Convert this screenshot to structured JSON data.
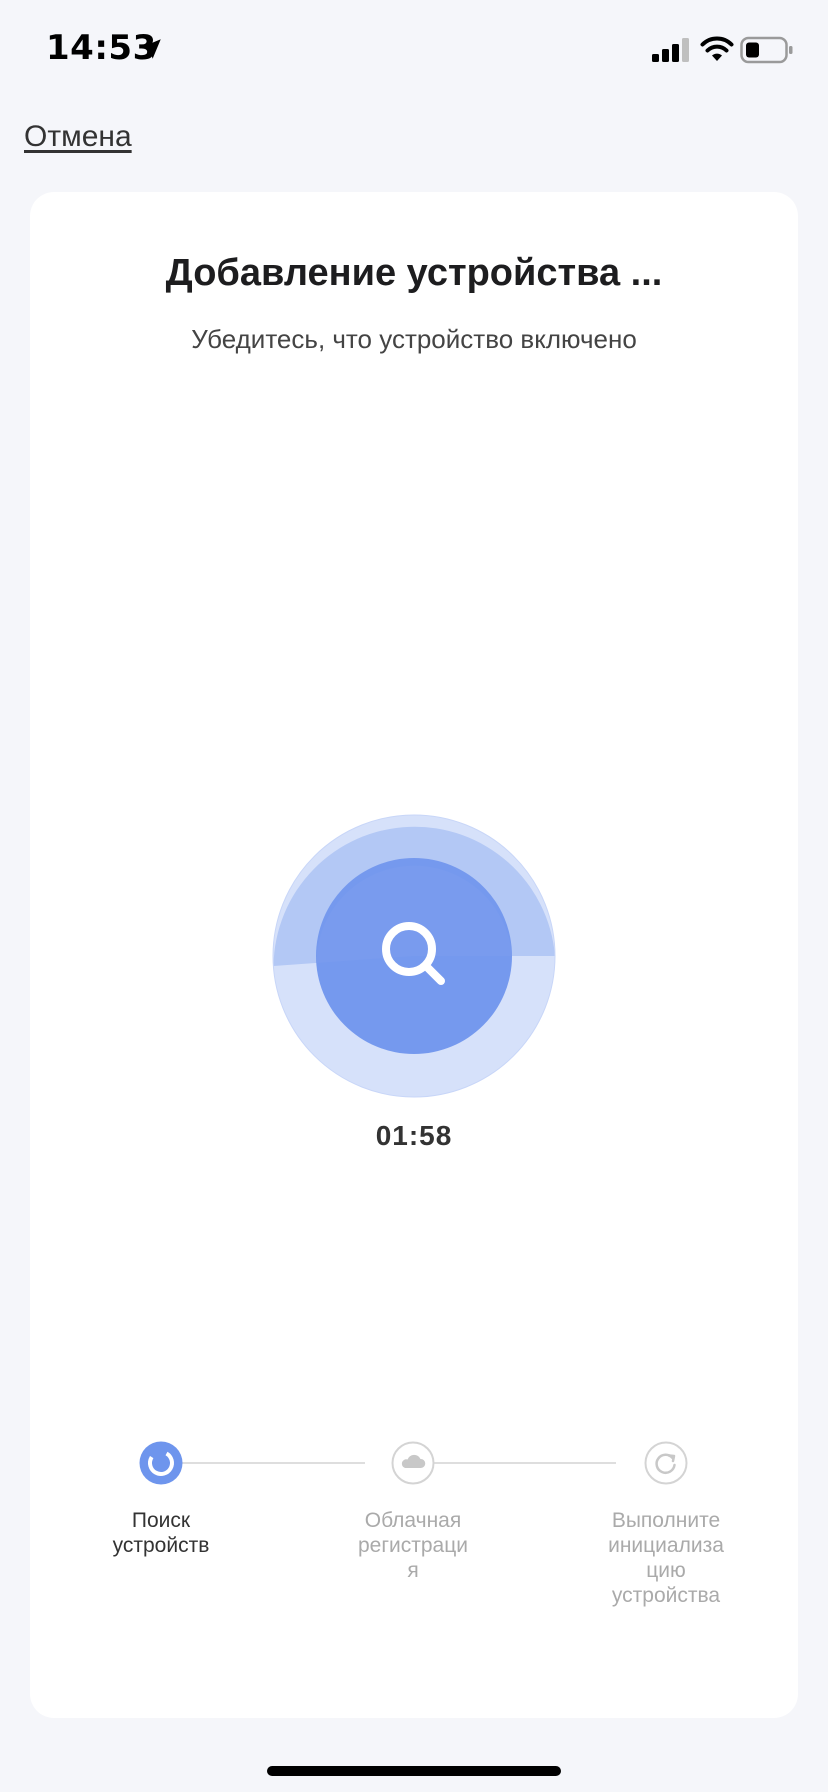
{
  "status_bar": {
    "time": "14:53",
    "icons": [
      "location-arrow-icon",
      "cellular-signal-icon",
      "wifi-icon",
      "battery-icon"
    ]
  },
  "header": {
    "cancel_label": "Отмена"
  },
  "card": {
    "title": "Добавление устройства ...",
    "subtitle": "Убедитесь, что устройство включено",
    "timer": "01:58"
  },
  "steps": [
    {
      "line1": "Поиск",
      "line2": "устройств",
      "line3": "",
      "line4": "",
      "state": "active",
      "icon": "loading-icon"
    },
    {
      "line1": "Облачная",
      "line2": "регистраци",
      "line3": "я",
      "line4": "",
      "state": "inactive",
      "icon": "cloud-icon"
    },
    {
      "line1": "Выполните",
      "line2": "инициализа",
      "line3": "цию",
      "line4": "устройства",
      "state": "inactive",
      "icon": "refresh-icon"
    }
  ],
  "colors": {
    "accent": "#6e95ed",
    "radar_outer": "#c2d2f7",
    "radar_sweep": "#a7bff3",
    "inactive": "#aaaaaa",
    "card_bg": "#ffffff",
    "page_bg": "#f5f6fa"
  }
}
